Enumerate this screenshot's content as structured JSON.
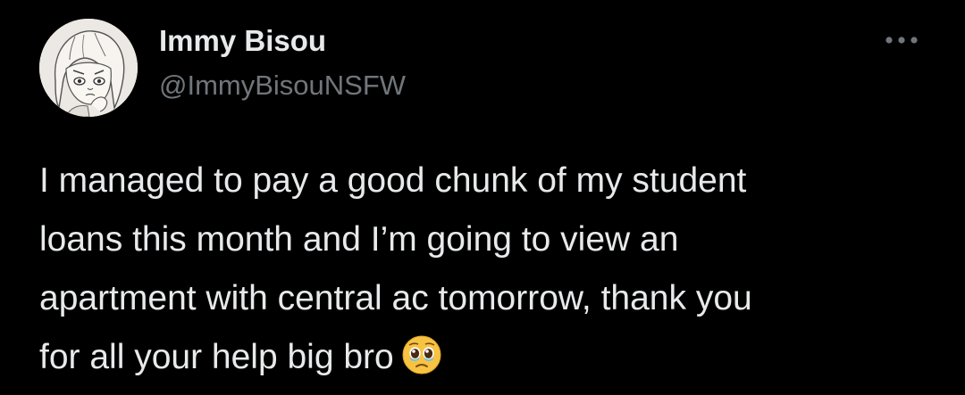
{
  "author": {
    "display_name": "Immy Bisou",
    "handle": "@ImmyBisouNSFW",
    "avatar_icon": "avatar-illustration"
  },
  "menu": {
    "icon": "more-options-icon"
  },
  "tweet": {
    "lines": [
      "I managed to pay a good chunk of my student",
      "loans this month and I’m going to view an",
      "apartment with central ac tomorrow, thank you",
      "for all your help big bro"
    ],
    "emoji": "pleading-face-with-tears-emoji"
  },
  "colors": {
    "background": "#000000",
    "primary_text": "#e7e9ea",
    "secondary_text": "#71767b"
  }
}
